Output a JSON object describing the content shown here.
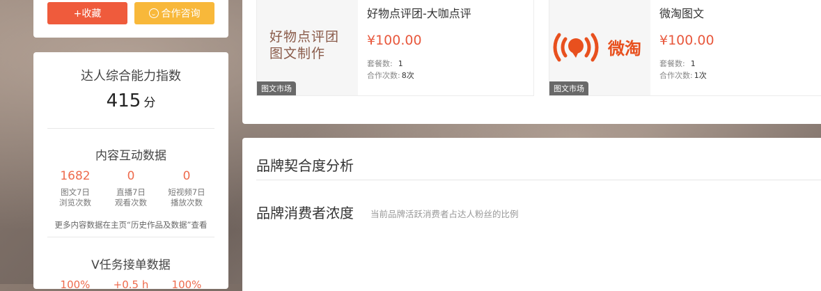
{
  "actions": {
    "collect_label": "+收藏",
    "consult_label": "合作咨询"
  },
  "ability": {
    "title": "达人综合能力指数",
    "score": "415",
    "unit": "分"
  },
  "content_data": {
    "title": "内容互动数据",
    "stats": [
      {
        "value": "1682",
        "label1": "图文7日",
        "label2": "浏览次数"
      },
      {
        "value": "0",
        "label1": "直播7日",
        "label2": "观看次数"
      },
      {
        "value": "0",
        "label1": "短视频7日",
        "label2": "播放次数"
      }
    ],
    "note": "更多内容数据在主页“历史作品及数据”查看"
  },
  "v_task": {
    "title": "V任务接单数据",
    "values": [
      "100%",
      "+0.5 h",
      "100%"
    ]
  },
  "products": [
    {
      "thumb_text_line1": "好物点评团",
      "thumb_text_line2": "图文制作",
      "badge": "图文市场",
      "title": "好物点评团-大咖点评",
      "price": "¥100.00",
      "package_label": "套餐数:",
      "package_count": "1",
      "coop_label": "合作次数:",
      "coop_count": "8次"
    },
    {
      "logo_text": "微淘",
      "badge": "图文市场",
      "title": "微淘图文",
      "price": "¥100.00",
      "package_label": "套餐数:",
      "package_count": "1",
      "coop_label": "合作次数:",
      "coop_count": "1次"
    }
  ],
  "brand_analysis": {
    "title": "品牌契合度分析",
    "sub_title": "品牌消费者浓度",
    "sub_desc": "当前品牌活跃消费者占达人粉丝的比例"
  },
  "colors": {
    "accent_orange": "#ef5b3c",
    "accent_yellow": "#f8b83a",
    "price_red": "#e8583d"
  }
}
